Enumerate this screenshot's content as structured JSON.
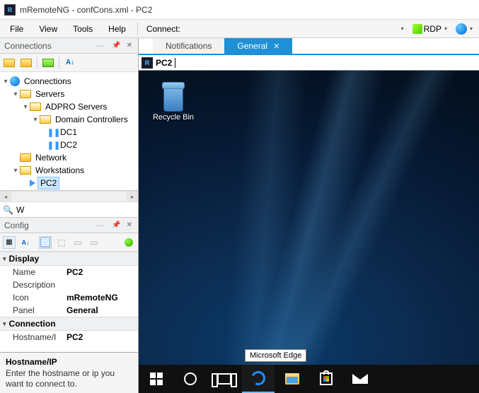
{
  "titlebar": {
    "title": "mRemoteNG - confCons.xml - PC2"
  },
  "menu": {
    "file": "File",
    "view": "View",
    "tools": "Tools",
    "help": "Help",
    "connect": "Connect:",
    "protocol": "RDP"
  },
  "connections_panel": {
    "title": "Connections",
    "search_value": "W",
    "tree": {
      "root": "Connections",
      "servers": "Servers",
      "adpro": "ADPRO Servers",
      "domain_controllers": "Domain Controllers",
      "dc1": "DC1",
      "dc2": "DC2",
      "network": "Network",
      "workstations": "Workstations",
      "pc2": "PC2"
    }
  },
  "config_panel": {
    "title": "Config",
    "cat_display": "Display",
    "cat_connection": "Connection",
    "rows": {
      "name_label": "Name",
      "name_value": "PC2",
      "desc_label": "Description",
      "desc_value": "",
      "icon_label": "Icon",
      "icon_value": "mRemoteNG",
      "panel_label": "Panel",
      "panel_value": "General",
      "host_label": "Hostname/I",
      "host_value": "PC2"
    },
    "help_title": "Hostname/IP",
    "help_text": "Enter the hostname or ip you want to connect to."
  },
  "tabs": {
    "notifications": "Notifications",
    "general": "General"
  },
  "address": {
    "value": "PC2"
  },
  "desktop": {
    "recycle": "Recycle Bin",
    "tooltip": "Microsoft Edge"
  }
}
